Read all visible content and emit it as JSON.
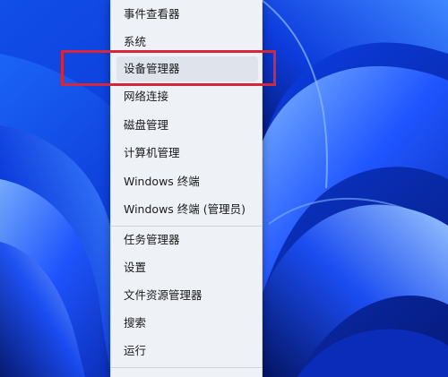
{
  "context_menu": {
    "items_top": [
      "事件查看器",
      "系统",
      "设备管理器",
      "网络连接",
      "磁盘管理",
      "计算机管理",
      "Windows 终端",
      "Windows 终端 (管理员)"
    ],
    "items_bottom": [
      "任务管理器",
      "设置",
      "文件资源管理器",
      "搜索",
      "运行"
    ],
    "highlighted_item": "设备管理器"
  },
  "colors": {
    "wallpaper": "#0a2a9a",
    "menu_background": "#eef1f6",
    "highlight_border": "#d4283a"
  },
  "icons": {
    "wallpaper": "windows-11-bloom-wallpaper"
  }
}
